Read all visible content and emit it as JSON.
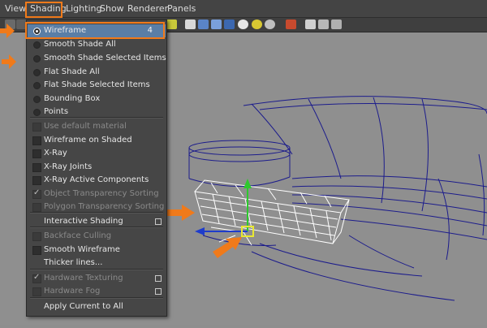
{
  "menubar": {
    "items": [
      "View",
      "Shading",
      "Lighting",
      "Show",
      "Renderer",
      "Panels"
    ],
    "active": "Shading"
  },
  "shading_menu": {
    "items": [
      {
        "label": "Wireframe",
        "kind": "radio",
        "checked": true,
        "shortcut": "4",
        "highlighted": true
      },
      {
        "label": "Smooth Shade All",
        "kind": "radio"
      },
      {
        "label": "Smooth Shade Selected Items",
        "kind": "radio"
      },
      {
        "label": "Flat Shade All",
        "kind": "radio"
      },
      {
        "label": "Flat Shade Selected Items",
        "kind": "radio"
      },
      {
        "label": "Bounding Box",
        "kind": "radio"
      },
      {
        "label": "Points",
        "kind": "radio"
      },
      {
        "label": "Use default material",
        "kind": "check",
        "disabled": true
      },
      {
        "label": "Wireframe on Shaded",
        "kind": "check"
      },
      {
        "label": "X-Ray",
        "kind": "check"
      },
      {
        "label": "X-Ray Joints",
        "kind": "check"
      },
      {
        "label": "X-Ray Active Components",
        "kind": "check"
      },
      {
        "label": "Object Transparency Sorting",
        "kind": "check",
        "checked": true,
        "disabled": true
      },
      {
        "label": "Polygon Transparency Sorting",
        "kind": "check",
        "disabled": true
      },
      {
        "label": "Interactive Shading",
        "kind": "plain",
        "option_box": true
      },
      {
        "label": "Backface Culling",
        "kind": "check",
        "disabled": true
      },
      {
        "label": "Smooth Wireframe",
        "kind": "check"
      },
      {
        "label": "Thicker lines...",
        "kind": "plain"
      },
      {
        "label": "Hardware Texturing",
        "kind": "check",
        "checked": true,
        "disabled": true,
        "option_box": true
      },
      {
        "label": "Hardware Fog",
        "kind": "check",
        "disabled": true,
        "option_box": true
      },
      {
        "label": "Apply Current to All",
        "kind": "plain"
      }
    ]
  },
  "colors": {
    "highlight": "#5a7ea6",
    "annotation_orange": "#f07a1a",
    "wireframe_blue": "#1c1c8c",
    "selected_wire": "#ffffff",
    "manip_green": "#2ec82e",
    "manip_blue": "#1e3ccc"
  }
}
